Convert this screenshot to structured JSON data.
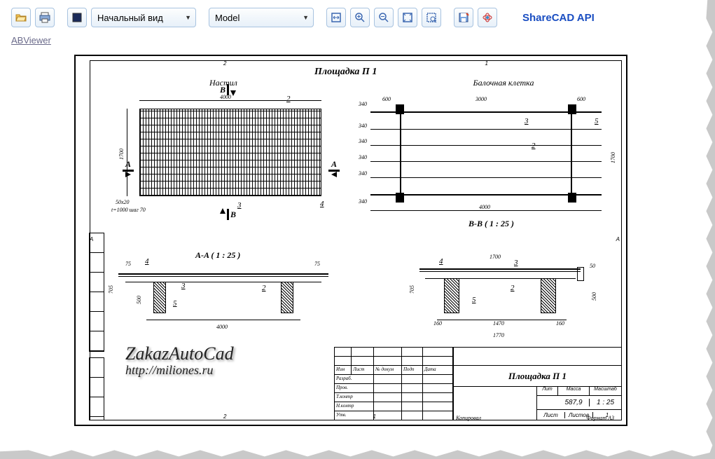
{
  "toolbar": {
    "view_select": "Начальный вид",
    "layout_select": "Model",
    "api_link": "ShareCAD API"
  },
  "app_link": "ABViewer",
  "drawing": {
    "main_title": "Площадка П 1",
    "view1_label": "Настил",
    "view2_label": "Балочная клетка",
    "section_aa": "A-A ( 1 : 25 )",
    "section_bb": "В-В ( 1 : 25 )",
    "dims": {
      "d4000": "4000",
      "d1700": "1700",
      "d600": "600",
      "d3000": "3000",
      "d340": "340",
      "d75": "75",
      "d705": "705",
      "d500": "500",
      "d160": "160",
      "d1470": "1470",
      "d1770": "1770",
      "d50": "50",
      "d500b": "500"
    },
    "callouts": {
      "c2": "2",
      "c3": "3",
      "c4": "4",
      "c5": "5"
    },
    "note1": "50x20",
    "note2": "t=1000 шаг 70",
    "section_marks": {
      "A": "A",
      "B": "В"
    },
    "frame_numbers": {
      "n1": "1",
      "n2": "2",
      "A": "А"
    },
    "titleblock": {
      "title": "Площадка П 1",
      "mass": "587,9",
      "scale": "1 : 25",
      "sheet_lbl": "Лист",
      "sheets_lbl": "Листов",
      "sheets_val": "1",
      "mass_lbl": "Масса",
      "scale_lbl": "Масштаб",
      "lit_lbl": "Лит",
      "format": "Формат A3",
      "copied": "Копировал"
    }
  },
  "watermark": {
    "line1": "ZakazAutoCad",
    "line2": "http://miliones.ru"
  }
}
